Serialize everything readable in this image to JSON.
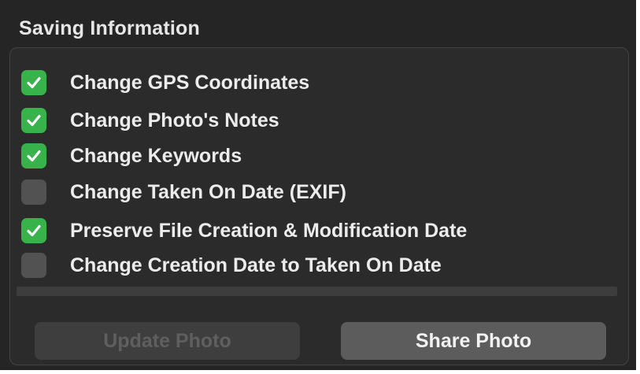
{
  "panel": {
    "title": "Saving Information"
  },
  "options": [
    {
      "label": "Change GPS Coordinates",
      "checked": true
    },
    {
      "label": "Change Photo's Notes",
      "checked": true
    },
    {
      "label": "Change Keywords",
      "checked": true
    },
    {
      "label": "Change Taken On Date (EXIF)",
      "checked": false
    },
    {
      "label": "Preserve File Creation & Modification Date",
      "checked": true
    },
    {
      "label": "Change Creation Date to Taken On Date",
      "checked": false
    }
  ],
  "progress": {
    "value": 0
  },
  "buttons": {
    "update_label": "Update Photo",
    "update_enabled": false,
    "share_label": "Share Photo",
    "share_enabled": true
  },
  "colors": {
    "checkbox_checked": "#38b24a",
    "checkbox_unchecked": "#525252",
    "panel_background": "#252525"
  }
}
